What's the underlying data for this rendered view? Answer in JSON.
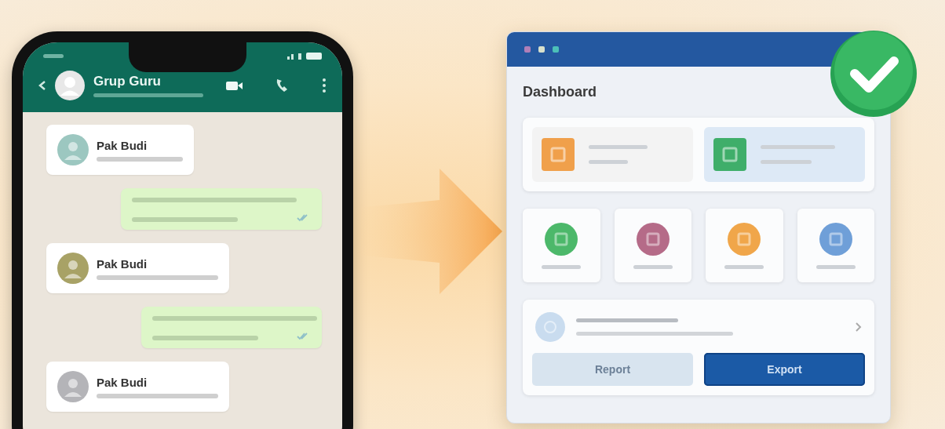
{
  "phone": {
    "chat_title": "Grup Guru",
    "messages": [
      {
        "kind": "incoming",
        "sender": "Pak Budi",
        "color": "#9cc7c0"
      },
      {
        "kind": "outgoing"
      },
      {
        "kind": "incoming",
        "sender": "Pak Budi",
        "color": "#a8a266"
      },
      {
        "kind": "outgoing"
      },
      {
        "kind": "incoming",
        "sender": "Pak Budi",
        "color": "#b4b4b8"
      }
    ]
  },
  "dashboard": {
    "window_dots": [
      {
        "color": "#b07fb8"
      },
      {
        "color": "#d8e0cc"
      },
      {
        "color": "#4cc0b8"
      }
    ],
    "title": "Dashboard",
    "stat_cards": [
      {
        "color": "#f0a04b"
      },
      {
        "color": "#3fae6a"
      }
    ],
    "shortcuts": [
      {
        "color": "#4cb86a"
      },
      {
        "color": "#b56b88"
      },
      {
        "color": "#f0a64a"
      },
      {
        "color": "#6f9fd8"
      }
    ],
    "buttons": [
      {
        "label": "Report",
        "kind": "secondary"
      },
      {
        "label": "Export",
        "kind": "primary"
      }
    ]
  }
}
